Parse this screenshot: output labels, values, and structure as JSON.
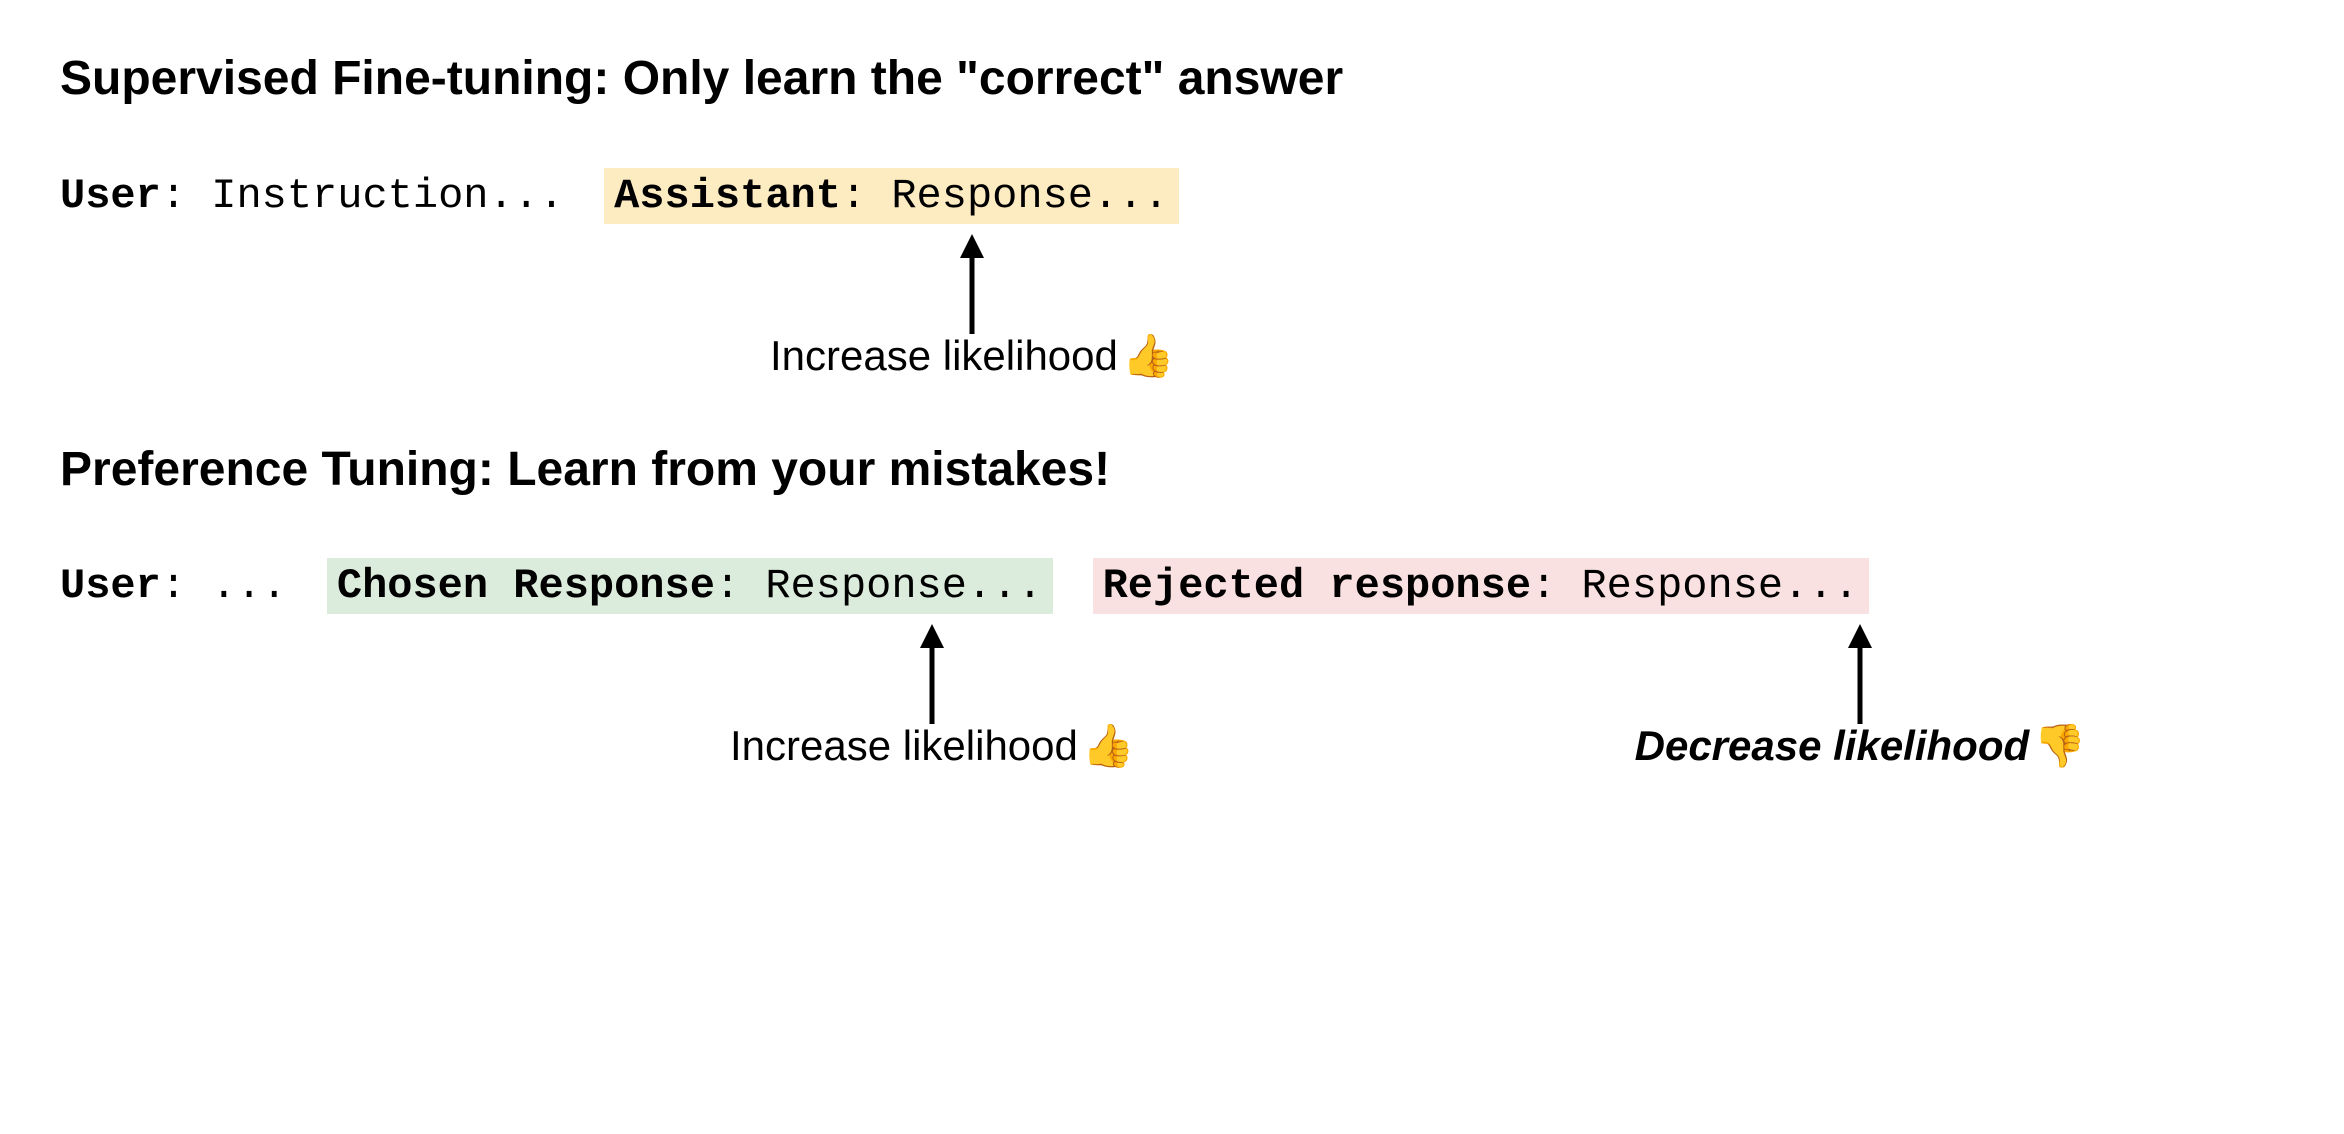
{
  "sft": {
    "title": "Supervised Fine-tuning: Only learn the \"correct\" answer",
    "user_label": "User",
    "user_text": ": Instruction...",
    "assistant_label": "Assistant",
    "assistant_text": ": Response...",
    "annotation": "Increase likelihood",
    "emoji": "👍"
  },
  "pref": {
    "title": "Preference Tuning: Learn from your mistakes!",
    "user_label": "User",
    "user_text": ": ...",
    "chosen_label": "Chosen Response",
    "chosen_text": ": Response...",
    "rejected_label": "Rejected response",
    "rejected_text": ": Response...",
    "chosen_annotation": "Increase likelihood",
    "chosen_emoji": "👍",
    "rejected_annotation": "Decrease likelihood",
    "rejected_emoji": "👎"
  },
  "colors": {
    "yellow": "#fdecc1",
    "green": "#dbecdc",
    "red": "#f9e0e1"
  }
}
